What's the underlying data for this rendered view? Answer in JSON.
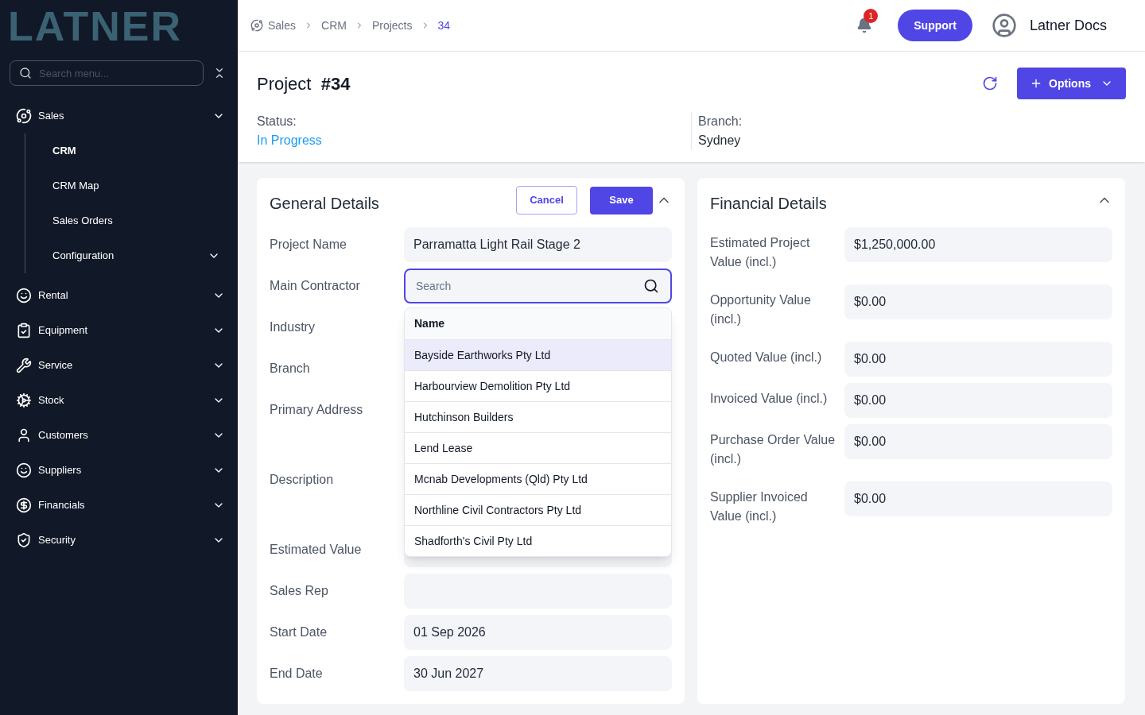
{
  "sidebar": {
    "logo": "LATNER",
    "search": {
      "placeholder": "Search menu..."
    },
    "items": [
      {
        "label": "Sales",
        "expanded": true,
        "children": [
          {
            "label": "CRM",
            "selected": true,
            "has_children": false
          },
          {
            "label": "CRM Map",
            "selected": false,
            "has_children": false
          },
          {
            "label": "Sales Orders",
            "selected": false,
            "has_children": false
          },
          {
            "label": "Configuration",
            "selected": false,
            "has_children": true
          }
        ]
      },
      {
        "label": "Rental"
      },
      {
        "label": "Equipment"
      },
      {
        "label": "Service"
      },
      {
        "label": "Stock"
      },
      {
        "label": "Customers"
      },
      {
        "label": "Suppliers"
      },
      {
        "label": "Financials"
      },
      {
        "label": "Security"
      }
    ]
  },
  "topbar": {
    "breadcrumb": [
      {
        "label": "Sales",
        "selected": false
      },
      {
        "label": "CRM",
        "selected": false
      },
      {
        "label": "Projects",
        "selected": false
      },
      {
        "label": "34",
        "selected": true
      }
    ],
    "notifications": "1",
    "support": "Support",
    "user": "Latner Docs"
  },
  "project": {
    "title": "Project",
    "number": "#34",
    "options": "Options",
    "status_label": "Status:",
    "status": "In Progress",
    "branch_label": "Branch:",
    "branch": "Sydney"
  },
  "general": {
    "title": "General Details",
    "cancel": "Cancel",
    "save": "Save",
    "fields": [
      {
        "label": "Project Name",
        "kind": "text",
        "value": "Parramatta Light Rail Stage 2"
      },
      {
        "label": "Main Contractor",
        "kind": "search",
        "placeholder": "Search"
      },
      {
        "label": "Industry",
        "kind": "covered"
      },
      {
        "label": "Branch",
        "kind": "covered"
      },
      {
        "label": "Primary Address",
        "kind": "covered_tall"
      },
      {
        "label": "Description",
        "kind": "covered_tall"
      },
      {
        "label": "Estimated Value",
        "kind": "text"
      },
      {
        "label": "Sales Rep",
        "kind": "text"
      },
      {
        "label": "Start Date",
        "kind": "text",
        "value": "01 Sep 2026"
      },
      {
        "label": "End Date",
        "kind": "text",
        "value": "30 Jun 2027"
      }
    ],
    "dropdown": {
      "header": "Name",
      "options": [
        {
          "label": "Bayside Earthworks Pty Ltd",
          "selected": true
        },
        {
          "label": "Harbourview Demolition Pty Ltd",
          "selected": false
        },
        {
          "label": "Hutchinson Builders",
          "selected": false
        },
        {
          "label": "Lend Lease",
          "selected": false
        },
        {
          "label": "Mcnab Developments (Qld) Pty Ltd",
          "selected": false
        },
        {
          "label": "Northline Civil Contractors Pty Ltd",
          "selected": false
        },
        {
          "label": "Shadforth's Civil Pty Ltd",
          "selected": false
        }
      ]
    }
  },
  "financial": {
    "title": "Financial Details",
    "fields": [
      {
        "label": "Estimated Project Value (incl.)",
        "value": "$1,250,000.00"
      },
      {
        "label": "Opportunity Value (incl.)",
        "value": "$0.00"
      },
      {
        "label": "Quoted Value (incl.)",
        "value": "$0.00"
      },
      {
        "label": "Invoiced Value (incl.)",
        "value": "$0.00"
      },
      {
        "label": "Purchase Order Value (incl.)",
        "value": "$0.00"
      },
      {
        "label": "Supplier Invoiced Value (incl.)",
        "value": "$0.00"
      }
    ]
  }
}
